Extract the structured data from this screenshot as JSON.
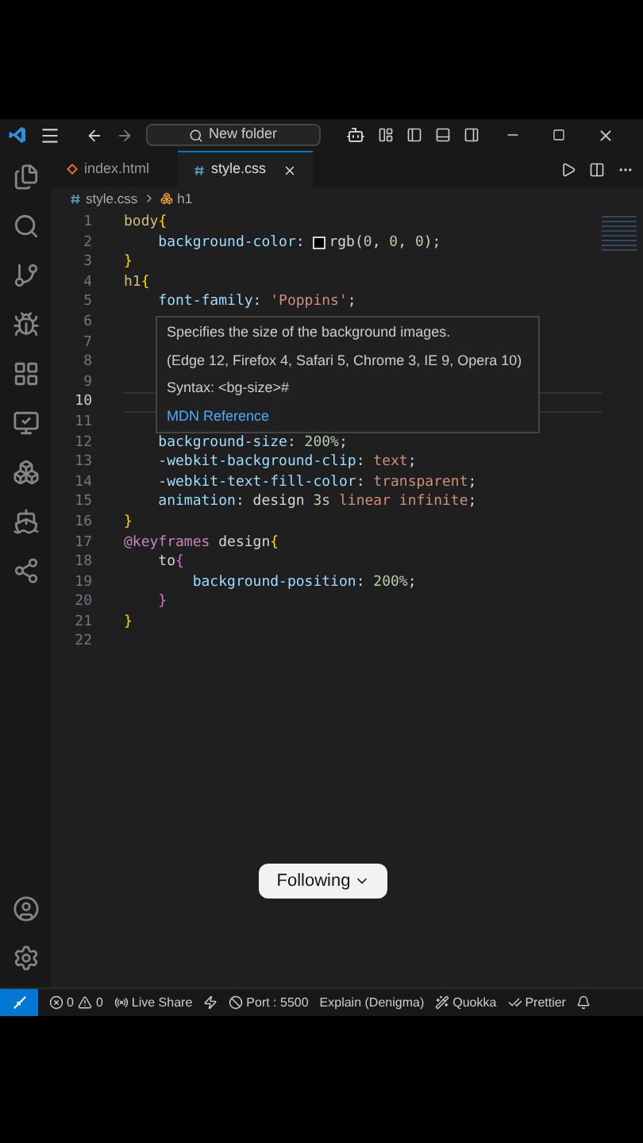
{
  "titlebar": {
    "search": "New folder"
  },
  "tabs": [
    {
      "label": "index.html",
      "kind": "html",
      "selected": false
    },
    {
      "label": "style.css",
      "kind": "css",
      "selected": true
    }
  ],
  "breadcrumb": {
    "file": "style.css",
    "symbol": "h1"
  },
  "editor": {
    "lines": [
      {
        "n": "1",
        "tokens": [
          {
            "kind": "sel",
            "text": "body"
          },
          {
            "kind": "brace",
            "text": "{"
          }
        ]
      },
      {
        "n": "2",
        "tokens": [
          {
            "kind": "prop",
            "text": "    background-color"
          },
          {
            "kind": "plain",
            "text": ": "
          },
          {
            "kind": "swatch",
            "color": "#000000"
          },
          {
            "kind": "plain",
            "text": "rgb("
          },
          {
            "kind": "num",
            "text": "0"
          },
          {
            "kind": "plain",
            "text": ", "
          },
          {
            "kind": "num",
            "text": "0"
          },
          {
            "kind": "plain",
            "text": ", "
          },
          {
            "kind": "num",
            "text": "0"
          },
          {
            "kind": "plain",
            "text": ");"
          }
        ]
      },
      {
        "n": "3",
        "tokens": [
          {
            "kind": "brace",
            "text": "}"
          }
        ]
      },
      {
        "n": "4",
        "tokens": [
          {
            "kind": "sel",
            "text": "h1"
          },
          {
            "kind": "brace",
            "text": "{"
          }
        ]
      },
      {
        "n": "5",
        "tokens": [
          {
            "kind": "prop",
            "text": "    font-family"
          },
          {
            "kind": "plain",
            "text": ": "
          },
          {
            "kind": "val",
            "text": "'Poppins'"
          },
          {
            "kind": "plain",
            "text": ";"
          }
        ]
      },
      {
        "n": "6"
      },
      {
        "n": "7"
      },
      {
        "n": "8"
      },
      {
        "n": "9"
      },
      {
        "n": "10",
        "active": true
      },
      {
        "n": "11"
      },
      {
        "n": "12",
        "tokens": [
          {
            "kind": "prop",
            "text": "    background-size"
          },
          {
            "kind": "plain",
            "text": ": "
          },
          {
            "kind": "num",
            "text": "200%"
          },
          {
            "kind": "plain",
            "text": ";"
          }
        ]
      },
      {
        "n": "13",
        "tokens": [
          {
            "kind": "prop",
            "text": "    -webkit-background-clip"
          },
          {
            "kind": "plain",
            "text": ": "
          },
          {
            "kind": "val",
            "text": "text"
          },
          {
            "kind": "plain",
            "text": ";"
          }
        ]
      },
      {
        "n": "14",
        "tokens": [
          {
            "kind": "prop",
            "text": "    -webkit-text-fill-color"
          },
          {
            "kind": "plain",
            "text": ": "
          },
          {
            "kind": "val",
            "text": "transparent"
          },
          {
            "kind": "plain",
            "text": ";"
          }
        ]
      },
      {
        "n": "15",
        "tokens": [
          {
            "kind": "prop",
            "text": "    animation"
          },
          {
            "kind": "plain",
            "text": ": design "
          },
          {
            "kind": "num",
            "text": "3s"
          },
          {
            "kind": "val",
            "text": " linear infinite"
          },
          {
            "kind": "plain",
            "text": ";"
          }
        ]
      },
      {
        "n": "16",
        "tokens": [
          {
            "kind": "brace",
            "text": "}"
          }
        ]
      },
      {
        "n": "17",
        "tokens": [
          {
            "kind": "kw",
            "text": "@keyframes"
          },
          {
            "kind": "plain",
            "text": " design"
          },
          {
            "kind": "brace",
            "text": "{"
          }
        ]
      },
      {
        "n": "18",
        "tokens": [
          {
            "kind": "plain",
            "text": "    to"
          },
          {
            "kind": "brace2",
            "text": "{"
          }
        ]
      },
      {
        "n": "19",
        "tokens": [
          {
            "kind": "prop",
            "text": "        background-position"
          },
          {
            "kind": "plain",
            "text": ": "
          },
          {
            "kind": "num",
            "text": "200%"
          },
          {
            "kind": "plain",
            "text": ";"
          }
        ]
      },
      {
        "n": "20",
        "tokens": [
          {
            "kind": "brace2",
            "text": "    }"
          }
        ]
      },
      {
        "n": "21",
        "tokens": [
          {
            "kind": "brace",
            "text": "}"
          }
        ]
      },
      {
        "n": "22"
      }
    ]
  },
  "hover": {
    "description": "Specifies the size of the background images.",
    "browsers": "(Edge 12, Firefox 4, Safari 5, Chrome 3, IE 9, Opera 10)",
    "syntax": "Syntax: <bg-size>#",
    "link": "MDN Reference"
  },
  "follow_button": "Following",
  "status_bar": [
    {
      "kind": "errors",
      "text": "0"
    },
    {
      "kind": "warnings",
      "text": "0"
    },
    {
      "kind": "liveshare",
      "text": "Live Share"
    },
    {
      "kind": "bolt"
    },
    {
      "kind": "port",
      "text": "Port : 5500"
    },
    {
      "kind": "plain",
      "text": "Explain (Denigma)"
    },
    {
      "kind": "quokka",
      "text": "Quokka"
    },
    {
      "kind": "check",
      "text": "Prettier"
    },
    {
      "kind": "bell"
    }
  ]
}
